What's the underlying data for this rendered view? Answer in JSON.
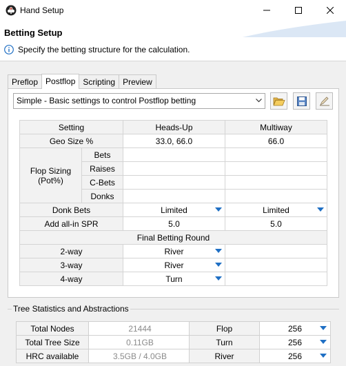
{
  "window": {
    "title": "Hand Setup"
  },
  "header": {
    "title": "Betting Setup",
    "description": "Specify the betting structure for the calculation."
  },
  "tabs": [
    {
      "label": "Preflop",
      "active": false
    },
    {
      "label": "Postflop",
      "active": true
    },
    {
      "label": "Scripting",
      "active": false
    },
    {
      "label": "Preview",
      "active": false
    }
  ],
  "preset": {
    "selected": "Simple - Basic settings to control Postflop betting"
  },
  "toolbar": {
    "open": "folder-open-icon",
    "save": "save-icon",
    "edit": "edit-icon"
  },
  "table": {
    "headers": {
      "setting": "Setting",
      "headsup": "Heads-Up",
      "multiway": "Multiway"
    },
    "geo": {
      "label": "Geo Size %",
      "headsup": "33.0, 66.0",
      "multiway": "66.0"
    },
    "flop_sizing": {
      "label_line1": "Flop Sizing",
      "label_line2": "(Pot%)",
      "rows": [
        {
          "label": "Bets",
          "headsup": "",
          "multiway": ""
        },
        {
          "label": "Raises",
          "headsup": "",
          "multiway": ""
        },
        {
          "label": "C-Bets",
          "headsup": "",
          "multiway": ""
        },
        {
          "label": "Donks",
          "headsup": "",
          "multiway": ""
        }
      ]
    },
    "donk_bets": {
      "label": "Donk Bets",
      "headsup": "Limited",
      "multiway": "Limited"
    },
    "allin_spr": {
      "label": "Add all-in SPR",
      "headsup": "5.0",
      "multiway": "5.0"
    },
    "final_round": {
      "title": "Final Betting Round",
      "rows": [
        {
          "label": "2-way",
          "value": "River"
        },
        {
          "label": "3-way",
          "value": "River"
        },
        {
          "label": "4-way",
          "value": "Turn"
        }
      ]
    }
  },
  "stats": {
    "legend": "Tree Statistics and Abstractions",
    "rows": [
      {
        "label": "Total Nodes",
        "value": "21444"
      },
      {
        "label": "Total Tree Size",
        "value": "0.11GB"
      },
      {
        "label": "HRC available",
        "value": "3.5GB / 4.0GB"
      }
    ],
    "abstractions": [
      {
        "label": "Flop",
        "value": "256"
      },
      {
        "label": "Turn",
        "value": "256"
      },
      {
        "label": "River",
        "value": "256"
      }
    ]
  },
  "colors": {
    "accent": "#1f6fc4",
    "banner": "#dbe7f5"
  }
}
